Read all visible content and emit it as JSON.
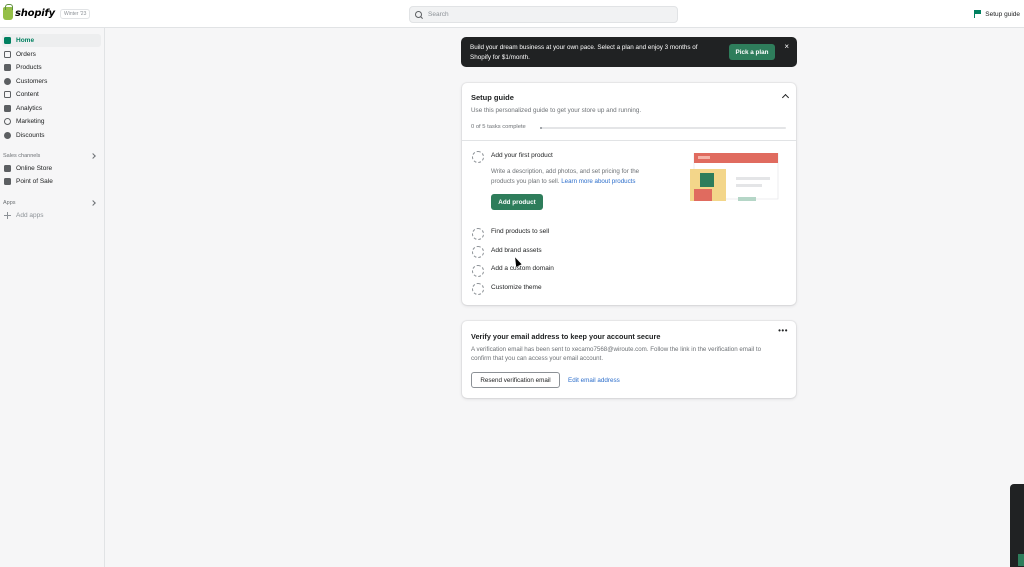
{
  "topbar": {
    "logo_text": "shopify",
    "edition": "Winter '23",
    "search_placeholder": "Search",
    "setup_guide": "Setup guide"
  },
  "sidebar": {
    "items": [
      {
        "label": "Home",
        "icon": "home-icon"
      },
      {
        "label": "Orders",
        "icon": "orders-icon"
      },
      {
        "label": "Products",
        "icon": "tag-icon"
      },
      {
        "label": "Customers",
        "icon": "person-icon"
      },
      {
        "label": "Content",
        "icon": "content-icon"
      },
      {
        "label": "Analytics",
        "icon": "bar-chart-icon"
      },
      {
        "label": "Marketing",
        "icon": "target-icon"
      },
      {
        "label": "Discounts",
        "icon": "discount-icon"
      }
    ],
    "sales_channels_label": "Sales channels",
    "channels": [
      {
        "label": "Online Store",
        "icon": "store-icon"
      },
      {
        "label": "Point of Sale",
        "icon": "pos-icon"
      }
    ],
    "apps_label": "Apps",
    "add_apps": "Add apps"
  },
  "banner": {
    "text": "Build your dream business at your own pace. Select a plan and enjoy 3 months of Shopify for $1/month.",
    "button": "Pick a plan",
    "close": "×"
  },
  "guide": {
    "title": "Setup guide",
    "description": "Use this personalized guide to get your store up and running.",
    "progress_text": "0 of 5 tasks complete",
    "progress_fraction": 0.01,
    "tasks": [
      {
        "title": "Add your first product"
      },
      {
        "title": "Find products to sell"
      },
      {
        "title": "Add brand assets"
      },
      {
        "title": "Add a custom domain"
      },
      {
        "title": "Customize theme"
      }
    ],
    "expanded": {
      "desc": "Write a description, add photos, and set pricing for the products you plan to sell.",
      "link": "Learn more about products",
      "button": "Add product"
    }
  },
  "verify": {
    "title": "Verify your email address to keep your account secure",
    "description": "A verification email has been sent to xecamo7568@wiroute.com. Follow the link in the verification email to confirm that you can access your email account.",
    "resend": "Resend verification email",
    "edit": "Edit email address",
    "more": "•••"
  },
  "colors": {
    "accent": "#008060",
    "button": "#2e7d5b",
    "link": "#2c6ecb",
    "banner_bg": "#202223"
  }
}
